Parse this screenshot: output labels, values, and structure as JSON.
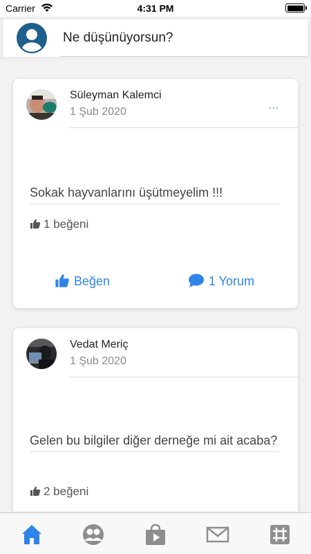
{
  "status_bar": {
    "carrier": "Carrier",
    "time": "4:31 PM"
  },
  "composer": {
    "placeholder": "Ne düşünüyorsun?"
  },
  "posts": [
    {
      "author": "Süleyman Kalemci",
      "date": "1 Şub 2020",
      "more": "...",
      "text": "Sokak hayvanlarını üşütmeyelim !!!",
      "likes": "1 beğeni",
      "like_action": "Beğen",
      "comment_action": "1 Yorum"
    },
    {
      "author": "Vedat Meriç",
      "date": "1 Şub 2020",
      "text": "Gelen bu bilgiler diğer derneğe mi ait acaba?",
      "likes": "2 beğeni"
    }
  ],
  "tabbar": {
    "items": [
      {
        "icon": "home-icon",
        "active": true
      },
      {
        "icon": "group-icon",
        "active": false
      },
      {
        "icon": "store-icon",
        "active": false
      },
      {
        "icon": "mail-icon",
        "active": false
      },
      {
        "icon": "grid-icon",
        "active": false
      }
    ]
  },
  "colors": {
    "accent": "#2f84e8",
    "inactive_icon": "#8e8e8e",
    "avatar_blue": "#1f5f8b"
  }
}
